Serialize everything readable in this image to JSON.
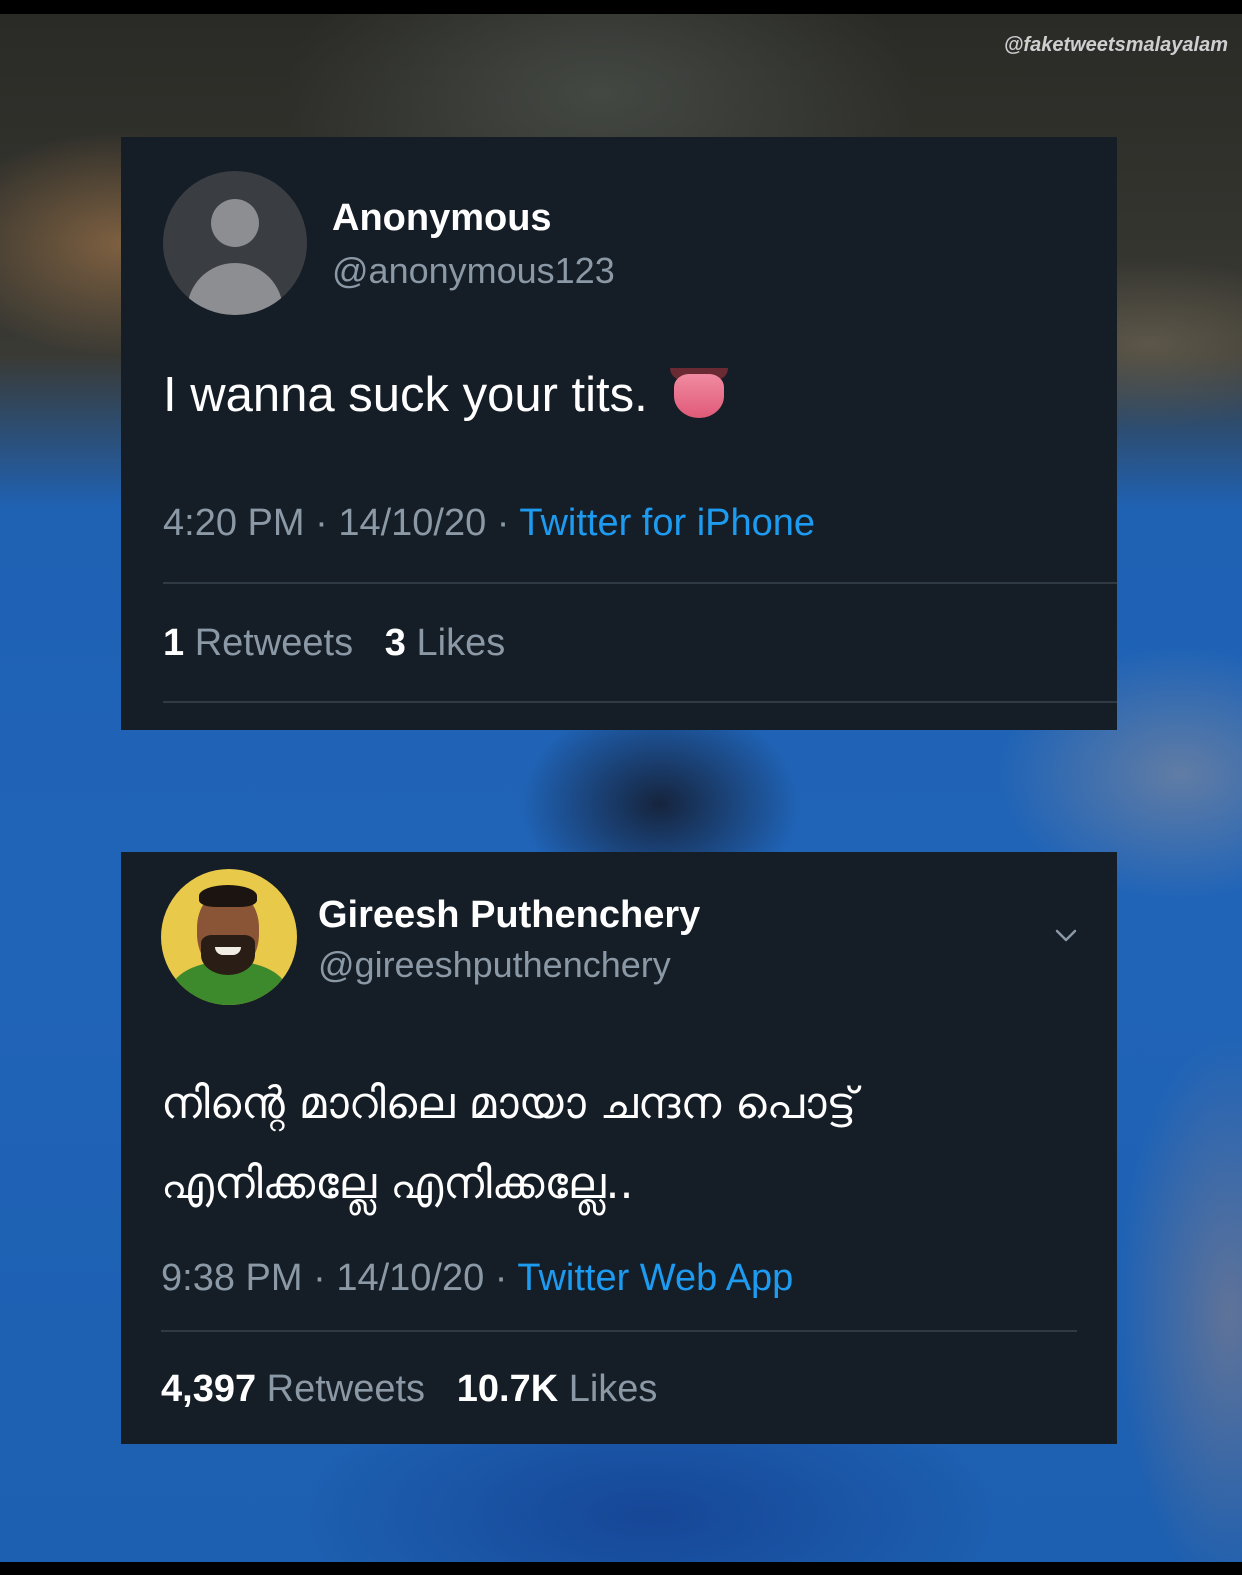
{
  "watermark": "@faketweetsmalayalam",
  "tweets": [
    {
      "name": "Anonymous",
      "handle": "@anonymous123",
      "text": "I wanna suck your tits.",
      "emoji": "tongue-emoji",
      "time": "4:20 PM",
      "sep1": " · ",
      "date": "14/10/20",
      "sep2": " · ",
      "source": "Twitter for iPhone",
      "retweets": "1",
      "retweets_label": "Retweets",
      "likes": "3",
      "likes_label": "Likes"
    },
    {
      "name": "Gireesh Puthenchery",
      "handle": "@gireeshputhenchery",
      "text": "നിന്റെ മാറിലെ മായാ ചന്ദന പൊട്ട് എനിക്കല്ലേ എനിക്കല്ലേ..",
      "time": "9:38 PM",
      "sep1": " · ",
      "date": "14/10/20",
      "sep2": " · ",
      "source": "Twitter Web App",
      "retweets": "4,397",
      "retweets_label": "Retweets",
      "likes": "10.7K",
      "likes_label": "Likes"
    }
  ],
  "colors": {
    "card_bg": "#151d26",
    "secondary_text": "#8b98a5",
    "link": "#1d9bf0"
  }
}
